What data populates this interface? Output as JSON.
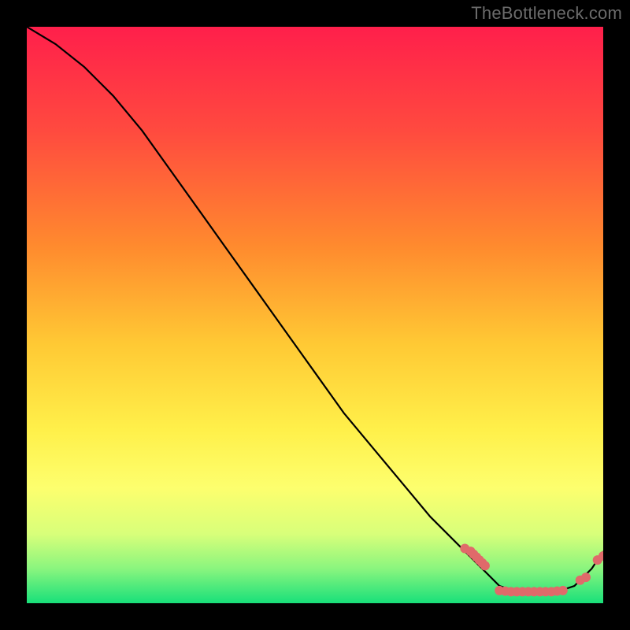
{
  "watermark": "TheBottleneck.com",
  "colors": {
    "frame": "#000000",
    "gradient_top": "#ff1f4b",
    "gradient_mid1": "#ff7a2a",
    "gradient_mid2": "#ffd23a",
    "gradient_mid3": "#fff06a",
    "gradient_mid4": "#d8ff7a",
    "gradient_bottom": "#18e07a",
    "curve": "#000000",
    "dots": "#e06a6a"
  },
  "chart_data": {
    "type": "line",
    "title": "",
    "xlabel": "",
    "ylabel": "",
    "xlim": [
      0,
      100
    ],
    "ylim": [
      0,
      100
    ],
    "series": [
      {
        "name": "bottleneck-curve",
        "x": [
          0,
          5,
          10,
          15,
          20,
          25,
          30,
          35,
          40,
          45,
          50,
          55,
          60,
          65,
          70,
          75,
          78,
          80,
          82,
          85,
          88,
          90,
          92,
          95,
          98,
          100
        ],
        "y": [
          100,
          97,
          93,
          88,
          82,
          75,
          68,
          61,
          54,
          47,
          40,
          33,
          27,
          21,
          15,
          10,
          7,
          5,
          3,
          2,
          2,
          2,
          2,
          3,
          6,
          9
        ]
      }
    ],
    "dot_clusters": [
      {
        "name": "descent-cluster",
        "points_x": [
          76,
          77,
          77.5,
          78,
          78.5,
          79,
          79.5
        ],
        "points_y": [
          9.5,
          9,
          8.5,
          8,
          7.5,
          7,
          6.5
        ]
      },
      {
        "name": "valley-cluster",
        "points_x": [
          82,
          83,
          84,
          85,
          86,
          87,
          88,
          89,
          90,
          91,
          92,
          93
        ],
        "points_y": [
          2.2,
          2.1,
          2.0,
          2.0,
          2.0,
          2.0,
          2.0,
          2.0,
          2.0,
          2.0,
          2.1,
          2.2
        ]
      },
      {
        "name": "rise-cluster",
        "points_x": [
          96,
          97,
          99,
          100
        ],
        "points_y": [
          4.0,
          4.5,
          7.5,
          8.2
        ]
      }
    ]
  }
}
